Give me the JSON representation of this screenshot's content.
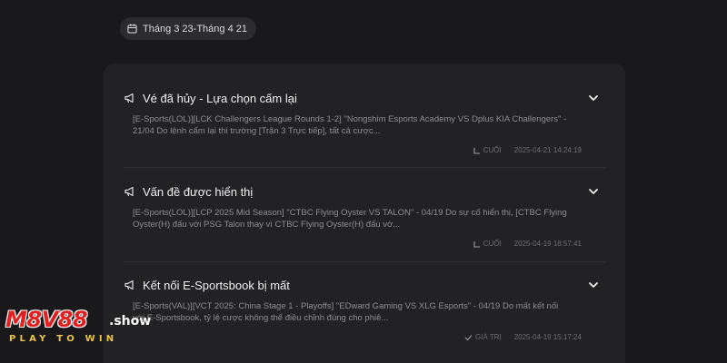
{
  "date_filter": {
    "label": "Tháng 3 23-Tháng 4 21"
  },
  "notices": [
    {
      "title": "Vé đã hủy - Lựa chọn cấm lại",
      "body": "[E-Sports(LOL)][LCK Challengers League Rounds 1-2] \"Nongshim Esports Academy VS Dplus KIA Challengers\" - 21/04 Do lệnh cấm lại thi trường [Trận 3 Trực tiếp], tất cả cược...",
      "tag_icon": "tag-icon",
      "tag": "CUỐI",
      "time": "2025-04-21 14:24:19"
    },
    {
      "title": "Vấn đề được hiển thị",
      "body": "[E-Sports(LOL)][LCP 2025 Mid Season] \"CTBC Flying Oyster VS TALON\" - 04/19 Do sự cố hiển thị, [CTBC Flying Oyster(H) đấu với PSG Talon thay vì CTBC Flying Oyster(H) đấu vớ...",
      "tag_icon": "tag-icon",
      "tag": "CUỐI",
      "time": "2025-04-19 18:57:41"
    },
    {
      "title": "Kết nối E-Sportsbook bị mất",
      "body": "[E-Sports(VAL)][VCT 2025: China Stage 1 - Playoffs] \"EDward Gaming VS XLG Esports\" - 04/19 Do mất kết nối với E-Sportsbook, tỷ lệ cược không thể điều chỉnh đúng cho phiê...",
      "tag_icon": "check-icon",
      "tag": "GIÁ TRỊ",
      "time": "2025-04-19 15:17:24"
    }
  ],
  "watermark": {
    "brand": "M8V88",
    "domain": ".show",
    "slogan": "PLAY TO WIN"
  },
  "colors": {
    "background": "#19191b",
    "panel": "#222225",
    "brand_red": "#e2201f",
    "slogan_gold": "#e9c34a"
  }
}
